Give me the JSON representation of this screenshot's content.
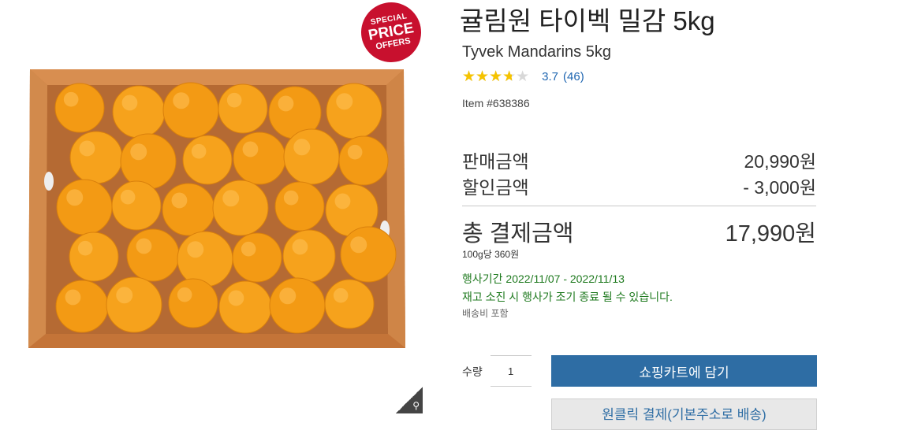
{
  "badge": {
    "line1": "SPECIAL",
    "line2": "PRICE",
    "line3": "OFFERS"
  },
  "product": {
    "title": "귤림원 타이벡 밀감 5kg",
    "subtitle": "Tyvek Mandarins 5kg",
    "rating": {
      "score": "3.7",
      "count": "(46)",
      "value": 3.7,
      "max": 5
    },
    "item_no": "Item #638386",
    "image_icon": "mandarin-box-photo"
  },
  "pricing": {
    "sale_label": "판매금액",
    "sale_value": "20,990원",
    "discount_label": "할인금액",
    "discount_value": "- 3,000원",
    "total_label": "총 결제금액",
    "total_value": "17,990원",
    "unit_price": "100g당 360원"
  },
  "promo": {
    "period": "행사기간 2022/11/07 - 2022/11/13",
    "notice": "재고 소진 시 행사가 조기 종료 될 수 있습니다.",
    "shipping": "배송비 포함"
  },
  "purchase": {
    "qty_label": "수량",
    "qty_value": "1",
    "cart_button": "쇼핑카트에 담기",
    "oneclick_button": "원클릭 결제(기본주소로 배송)"
  },
  "colors": {
    "accent": "#2e6da4",
    "promo_green": "#1f7a1f",
    "badge_red": "#c8102e",
    "star": "#f5c300"
  },
  "icons": {
    "zoom": "magnifier-icon"
  }
}
